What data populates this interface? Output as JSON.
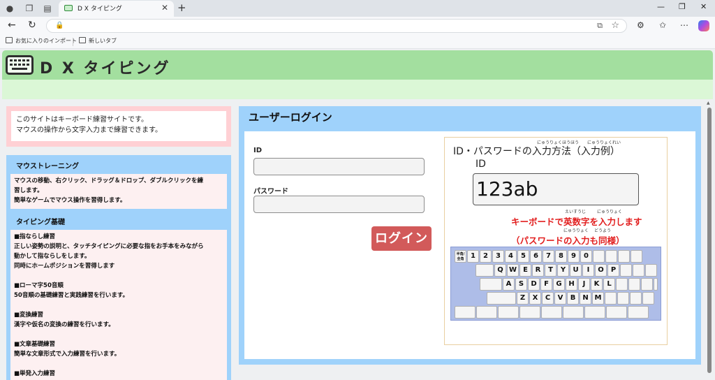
{
  "browser": {
    "tab_title": "D X タイピング",
    "close_glyph": "✕",
    "new_tab_glyph": "+",
    "favorites": [
      {
        "label": "お気に入りのインポート"
      },
      {
        "label": "新しいタブ"
      }
    ]
  },
  "site": {
    "title": "D X タイピング",
    "intro_lines": [
      "このサイトはキーボード練習サイトです。",
      "マウスの操作から文字入力まで練習できます。"
    ]
  },
  "sidebar": {
    "sections": [
      {
        "heading": "マウストレーニング",
        "lines": [
          "マウスの移動、右クリック、ドラッグ＆ドロップ、ダブルクリックを練",
          "習します。",
          "簡単なゲームでマウス操作を習得します。"
        ]
      },
      {
        "heading": "タイピング基礎",
        "items": [
          {
            "title": "■指ならし練習",
            "lines": [
              "正しい姿勢の説明と、タッチタイピングに必要な指をお手本をみながら",
              "動かして指ならしをします。",
              "同時にホームポジションを習得します"
            ]
          },
          {
            "title": "■ローマ字50音順",
            "lines": [
              "50音順の基礎練習と実践練習を行います。"
            ]
          },
          {
            "title": "■変換練習",
            "lines": [
              "漢字や仮名の変換の練習を行います。"
            ]
          },
          {
            "title": "■文章基礎練習",
            "lines": [
              "簡単な文章形式で入力練習を行います。"
            ]
          },
          {
            "title": "■単発入力練習",
            "lines": []
          }
        ]
      }
    ]
  },
  "login": {
    "title": "ユーザーログイン",
    "id_label": "ID",
    "id_value": "",
    "password_label": "パスワード",
    "password_value": "",
    "button_label": "ログイン",
    "help": {
      "title": "ID・パスワードの入力方法（入力例）",
      "title_ruby_1": "にゅうりょくほうほう",
      "title_ruby_2": "にゅうりょくれい",
      "id_label": "ID",
      "example_value": "123ab",
      "instruction_1": "キーボードで英数字を入力します",
      "instruction_1_ruby_1": "えいすうじ",
      "instruction_1_ruby_2": "にゅうりょく",
      "instruction_2": "（パスワードの入力も同様）",
      "instruction_2_ruby_1": "にゅうりょく",
      "instruction_2_ruby_2": "どうよう"
    },
    "keyboard_rows": [
      [
        "半角/全角",
        "1",
        "2",
        "3",
        "4",
        "5",
        "6",
        "7",
        "8",
        "9",
        "0",
        "",
        "",
        "",
        ""
      ],
      [
        "",
        "Q",
        "W",
        "E",
        "R",
        "T",
        "Y",
        "U",
        "I",
        "O",
        "P",
        "",
        "",
        ""
      ],
      [
        "",
        "A",
        "S",
        "D",
        "F",
        "G",
        "H",
        "J",
        "K",
        "L",
        "",
        "",
        "",
        ""
      ],
      [
        "",
        "Z",
        "X",
        "C",
        "V",
        "B",
        "N",
        "M",
        "",
        "",
        "",
        ""
      ],
      [
        "",
        "",
        "",
        "",
        "",
        "",
        "",
        "",
        ""
      ]
    ]
  },
  "colors": {
    "header_green": "#a3df9f",
    "panel_blue": "#9fd2fb",
    "intro_pink": "#ffd0d4",
    "login_button": "#d25a5a",
    "instruction_red": "#e21e1e"
  }
}
